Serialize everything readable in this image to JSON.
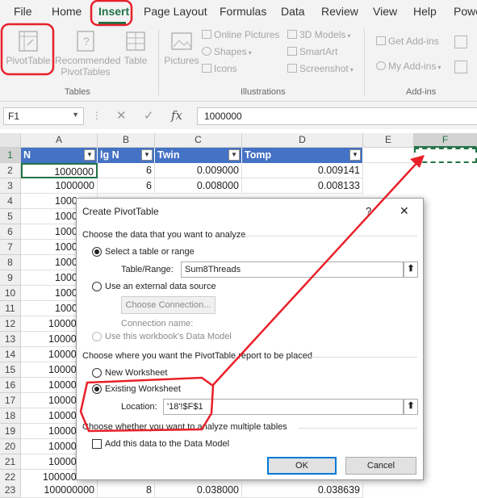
{
  "ribbon_tabs": [
    "File",
    "Home",
    "Insert",
    "Page Layout",
    "Formulas",
    "Data",
    "Review",
    "View",
    "Help",
    "Powe"
  ],
  "ribbon": {
    "tables": {
      "pivottable": "PivotTable",
      "recommended1": "Recommended",
      "recommended2": "PivotTables",
      "table": "Table",
      "group": "Tables"
    },
    "illustrations": {
      "pictures": "Pictures",
      "online_pictures": "Online Pictures",
      "shapes": "Shapes",
      "icons": "Icons",
      "models_3d": "3D Models",
      "smartart": "SmartArt",
      "screenshot": "Screenshot",
      "group": "Illustrations"
    },
    "addins": {
      "get": "Get Add-ins",
      "my": "My Add-ins",
      "group": "Add-ins"
    }
  },
  "formula_bar": {
    "name_box": "F1",
    "fx": "fx",
    "value": "1000000"
  },
  "columns": [
    "A",
    "B",
    "C",
    "D",
    "E",
    "F"
  ],
  "selected_column": "F",
  "header_row": {
    "n": "N",
    "lgn": "lg N",
    "twin": "Twin",
    "tomp": "Tomp"
  },
  "rows": [
    {
      "r": "2",
      "a": "1000000",
      "b": "6",
      "c": "0.009000",
      "d": "0.009141"
    },
    {
      "r": "3",
      "a": "1000000",
      "b": "6",
      "c": "0.008000",
      "d": "0.008133"
    },
    {
      "r": "4",
      "a": "1000"
    },
    {
      "r": "5",
      "a": "1000"
    },
    {
      "r": "6",
      "a": "1000"
    },
    {
      "r": "7",
      "a": "1000"
    },
    {
      "r": "8",
      "a": "1000"
    },
    {
      "r": "9",
      "a": "1000"
    },
    {
      "r": "10",
      "a": "1000"
    },
    {
      "r": "11",
      "a": "1000"
    },
    {
      "r": "12",
      "a": "10000"
    },
    {
      "r": "13",
      "a": "10000"
    },
    {
      "r": "14",
      "a": "10000"
    },
    {
      "r": "15",
      "a": "10000"
    },
    {
      "r": "16",
      "a": "10000"
    },
    {
      "r": "17",
      "a": "10000"
    },
    {
      "r": "18",
      "a": "10000"
    },
    {
      "r": "19",
      "a": "10000"
    },
    {
      "r": "20",
      "a": "10000"
    },
    {
      "r": "21",
      "a": "10000"
    },
    {
      "r": "22",
      "a": "100000"
    },
    {
      "r": "23",
      "a": "100000000",
      "b": "8",
      "c": "0.038000",
      "d": "0.038639"
    }
  ],
  "dialog": {
    "title": "Create PivotTable",
    "help": "?",
    "close": "✕",
    "section1": "Choose the data that you want to analyze",
    "opt_table": "Select a table or range",
    "table_range_label": "Table/Range:",
    "table_range_value": "Sum8Threads",
    "opt_external": "Use an external data source",
    "choose_connection": "Choose Connection...",
    "connection_name_label": "Connection name:",
    "opt_datamodel": "Use this workbook's Data Model",
    "section2": "Choose where you want the PivotTable report to be placed",
    "opt_new": "New Worksheet",
    "opt_existing": "Existing Worksheet",
    "location_label": "Location:",
    "location_value": "'18'!$F$1",
    "section3": "Choose whether you want to analyze multiple tables",
    "add_datamodel": "Add this data to the Data Model",
    "ok": "OK",
    "cancel": "Cancel"
  },
  "colors": {
    "accent": "#217346",
    "table_header": "#4472c4",
    "annotation": "#e8202a"
  }
}
